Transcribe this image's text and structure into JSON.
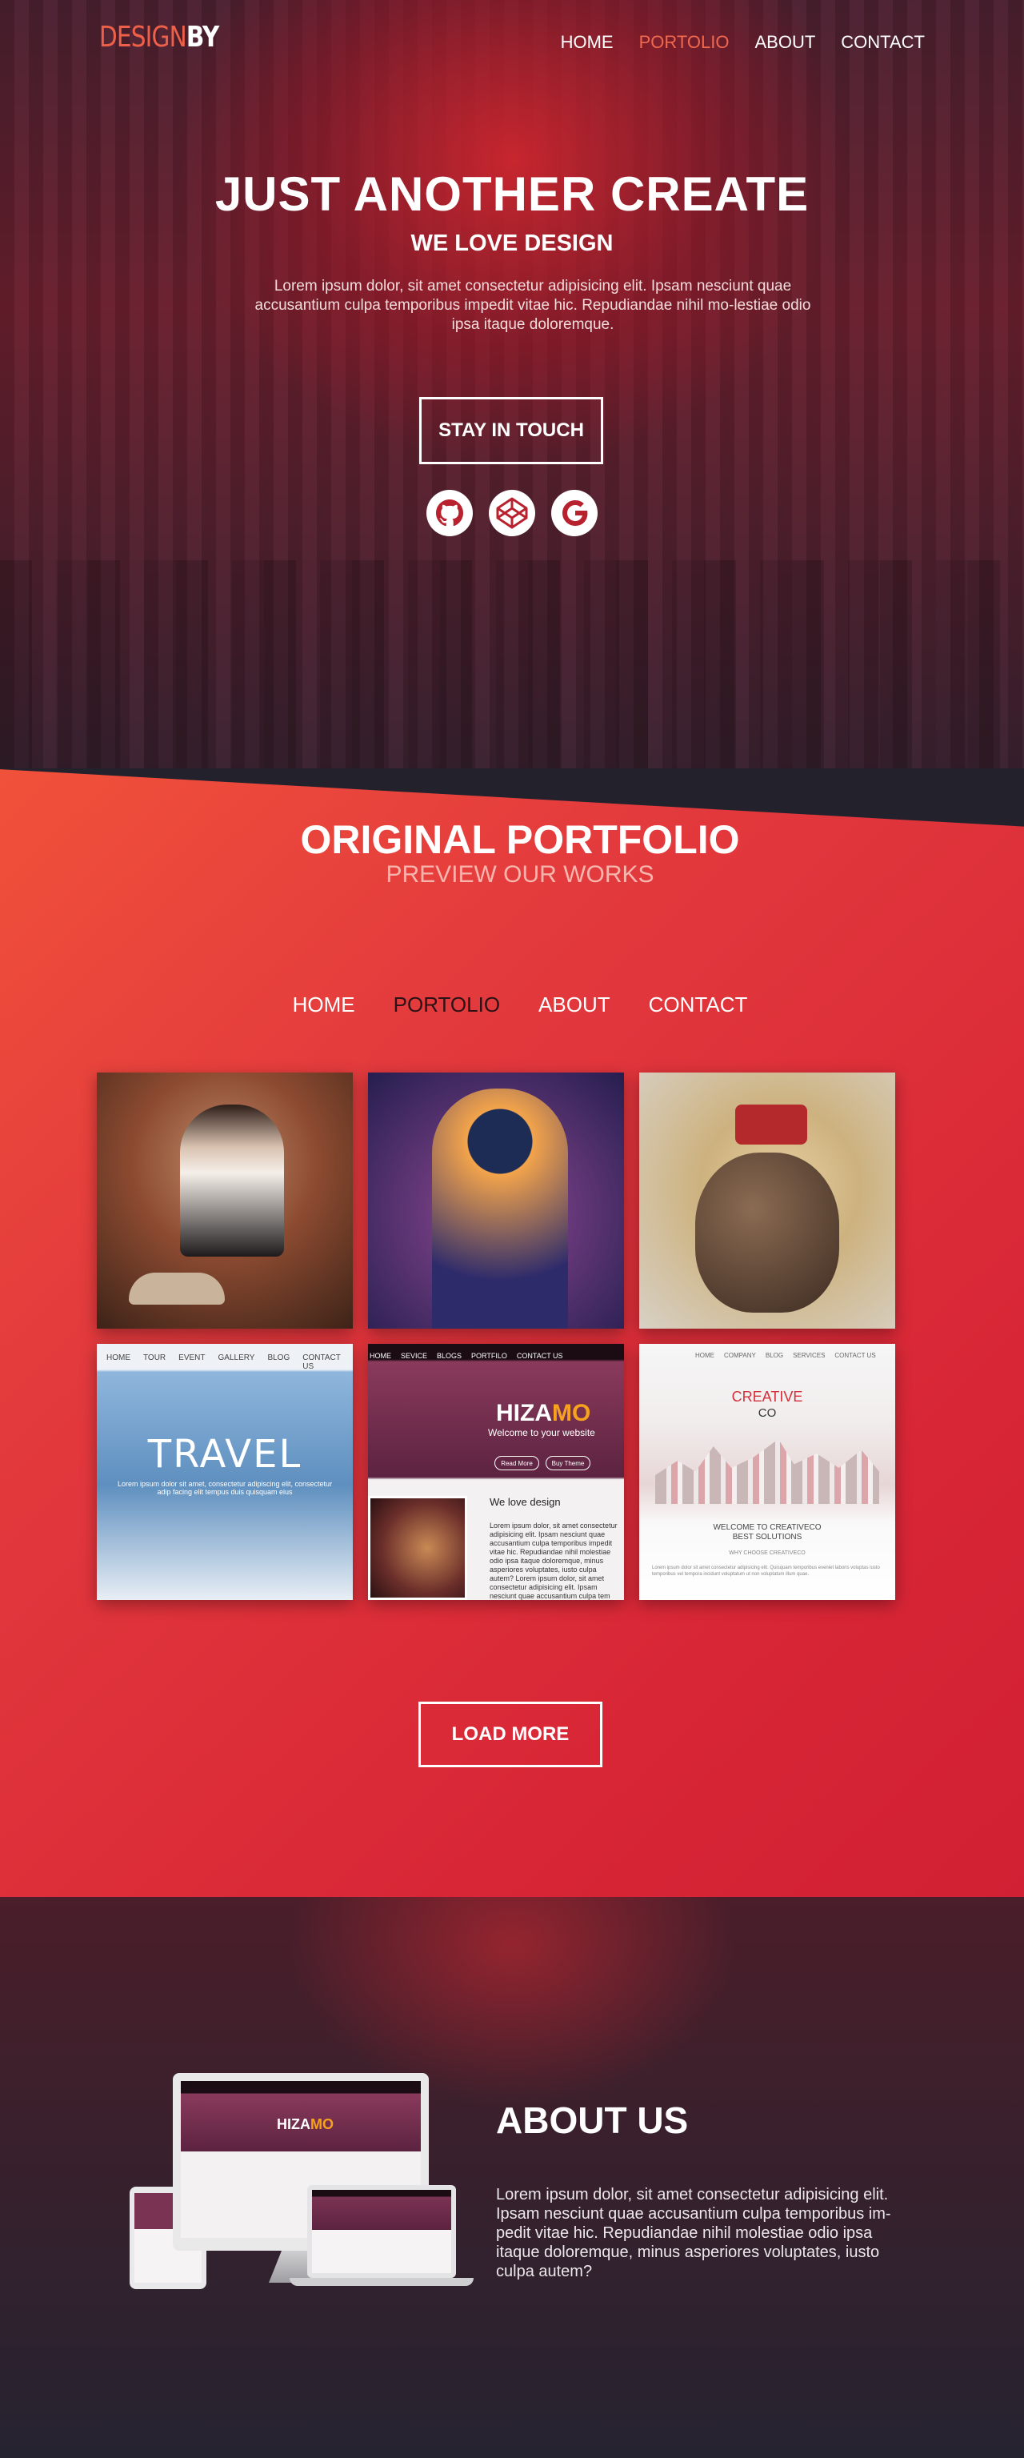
{
  "brand": {
    "part1": "DESIGN",
    "part2": "BY",
    "accent": "#ef6049"
  },
  "nav": [
    "HOME",
    "PORTOLIO",
    "ABOUT",
    "CONTACT"
  ],
  "hero": {
    "title": "JUST ANOTHER CREATE",
    "subtitle": "WE LOVE DESIGN",
    "text": "Lorem ipsum dolor, sit amet consectetur adipisicing elit. Ipsam nesciunt quae accusantium culpa temporibus impedit vitae hic. Repudiandae nihil mo-lestiae odio ipsa itaque doloremque.",
    "cta": "STAY IN TOUCH",
    "socials": [
      "github-icon",
      "codepen-icon",
      "google-icon"
    ]
  },
  "portfolio": {
    "title": "ORIGINAL PORTFOLIO",
    "subtitle": "PREVIEW OUR WORKS",
    "filters": [
      "HOME",
      "PORTOLIO",
      "ABOUT",
      "CONTACT"
    ],
    "load_more": "LOAD  MORE",
    "tile4": {
      "nav": [
        "HOME",
        "TOUR",
        "EVENT",
        "GALLERY",
        "BLOG",
        "CONTACT US"
      ],
      "headline": "TRAVEL",
      "text": "Lorem ipsum dolor sit amet, consectetur adipiscing elit, consectetur adip facing elit tempus duis quisquam eius"
    },
    "tile5": {
      "nav": [
        "HOME",
        "SEVICE",
        "BLOGS",
        "PORTFILO",
        "CONTACT US"
      ],
      "brand1": "HIZA",
      "brand2": "MO",
      "welcome": "Welcome to your website",
      "btn1": "Read More",
      "btn2": "Buy Theme",
      "heading": "We love design",
      "text": "Lorem ipsum dolor, sit amet consectetur adipisicing elit. Ipsam nesciunt quae accusantium culpa temporibus impedit vitae hic. Repudiandae nihil molestiae odio ipsa itaque doloremque, minus asperiores voluptates, iusto culpa autem? Lorem ipsum dolor, sit amet consectetur adipisicing elit. Ipsam nesciunt quae accusantium culpa tem"
    },
    "tile6": {
      "nav": [
        "HOME",
        "COMPANY",
        "BLOG",
        "SERVICES",
        "CONTACT US"
      ],
      "title": "CREATIVE",
      "subtitle": "CO",
      "welcome1": "WELCOME TO CREATIVECO",
      "welcome2": "BEST SOLUTIONS",
      "why": "WHY CHOOSE CREATIVECO",
      "text": "Lorem ipsum dolor sit amet consectetur adipisicing elit. Quisquam temporibus eveniet laboris voluptas iusto temporibus vel tempora incidunt voluptatum ut non voluptatum illum quae."
    }
  },
  "about": {
    "title": "ABOUT US",
    "text": "Lorem ipsum dolor, sit amet consectetur adipisicing elit. Ipsam nesciunt quae accusantium culpa temporibus im-pedit vitae hic. Repudiandae nihil molestiae odio ipsa itaque doloremque, minus asperiores voluptates, iusto culpa autem?",
    "mockup_brand1": "HIZA",
    "mockup_brand2": "MO"
  }
}
